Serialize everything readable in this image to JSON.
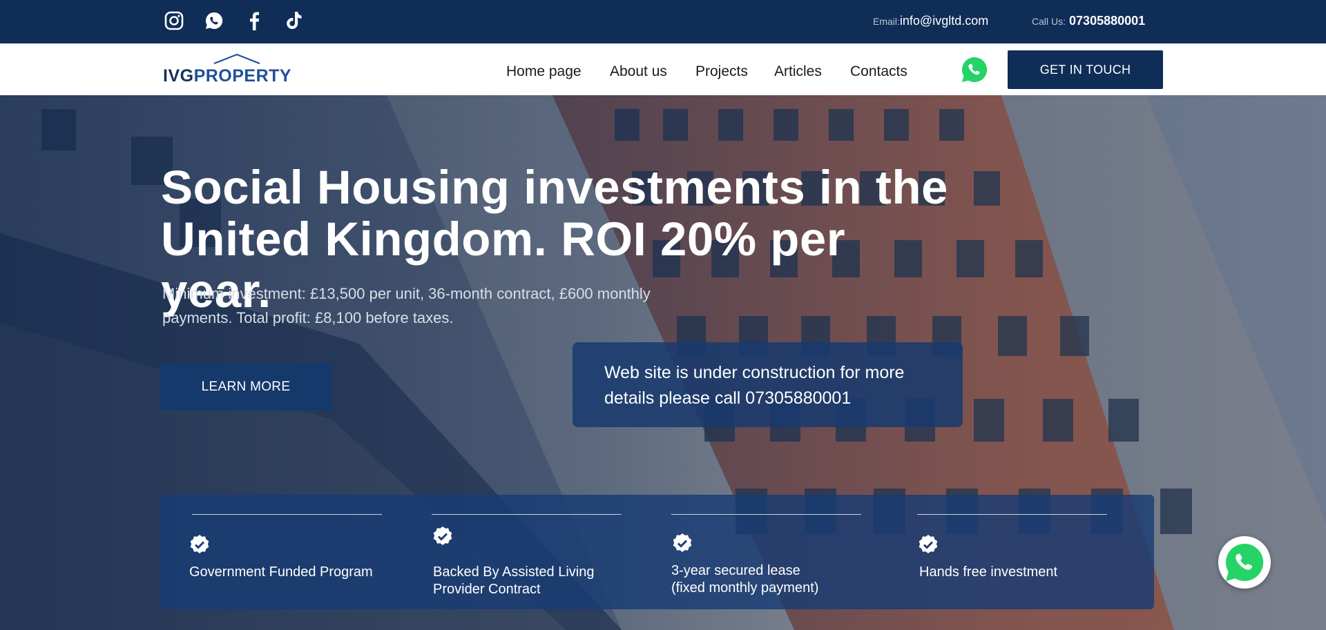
{
  "topbar": {
    "social_icons": [
      "instagram-icon",
      "whatsapp-icon",
      "facebook-icon",
      "tiktok-icon"
    ],
    "email_label": "Email:",
    "email_value": "info@ivgltd.com",
    "phone_label": "Call Us:",
    "phone_value": "07305880001"
  },
  "logo": {
    "part1": "IVG",
    "part2": "PROPERTY"
  },
  "nav": {
    "items": [
      "Home page",
      "About us",
      "Projects",
      "Articles",
      "Contacts"
    ],
    "cta_label": "GET IN TOUCH"
  },
  "hero": {
    "headline_line1": "Social Housing investments in the",
    "headline_line2": "United Kingdom. ROI 20% per year.",
    "subtext_line1": "Minimum investment: £13,500 per unit, 36-month contract, £600 monthly",
    "subtext_line2": "payments. Total profit: £8,100 before taxes.",
    "learn_more_label": "LEARN MORE",
    "notice_line1": "Web site is under construction for more",
    "notice_line2": "details please call 07305880001"
  },
  "features": [
    {
      "line1": "Government Funded Program",
      "line2": ""
    },
    {
      "line1": "Backed By Assisted Living",
      "line2": "Provider Contract"
    },
    {
      "line1": "3-year secured lease",
      "line2": "(fixed monthly payment)"
    },
    {
      "line1": "Hands free investment",
      "line2": ""
    }
  ],
  "colors": {
    "navy": "#0f2d57",
    "whatsapp_green": "#25d366",
    "panel_blue": "#183c74"
  }
}
